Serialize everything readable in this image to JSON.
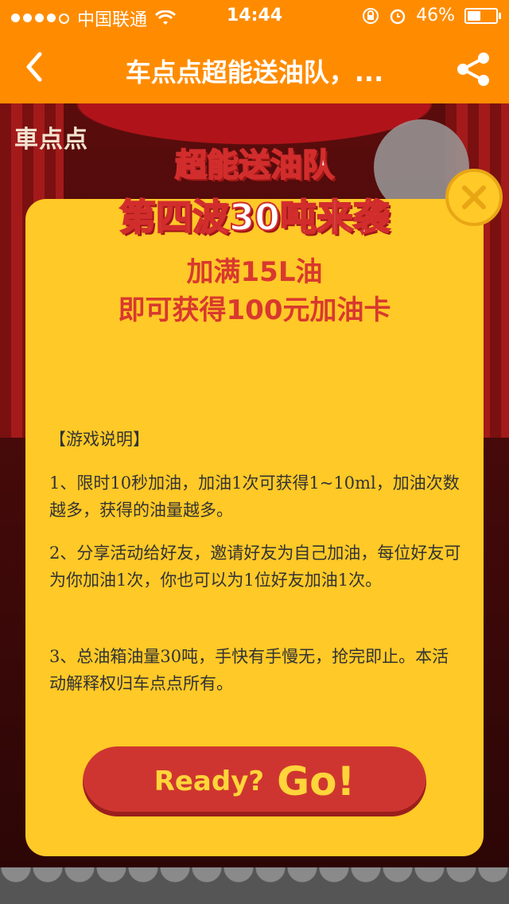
{
  "status_bar": {
    "carrier": "中国联通",
    "time": "14:44",
    "battery": "46%",
    "battery_level": 0.46
  },
  "nav": {
    "title": "车点点超能送油队，..."
  },
  "stage": {
    "logo_text": "車点点"
  },
  "modal": {
    "headline_line1": "超能送油队",
    "headline_line2": "第四波30吨来袭",
    "prize_line1": "加满15L油",
    "prize_line2": "即可获得100元加油卡",
    "desc_title": "【游戏说明】",
    "desc_1": "1、限时10秒加油，加油1次可获得1~10ml，加油次数越多，获得的油量越多。",
    "desc_2": "2、分享活动给好友，邀请好友为自己加油，每位好友可为你加油1次，你也可以为1位好友加油1次。",
    "desc_3": "3、总油箱油量30吨，手快有手慢无，抢完即止。本活动解释权归车点点所有。",
    "button_ready": "Ready?",
    "button_go": "Go!"
  },
  "colors": {
    "brand_orange": "#ff8c00",
    "modal_yellow": "#ffc927",
    "button_red": "#cf3530",
    "text_red": "#d8392e"
  }
}
